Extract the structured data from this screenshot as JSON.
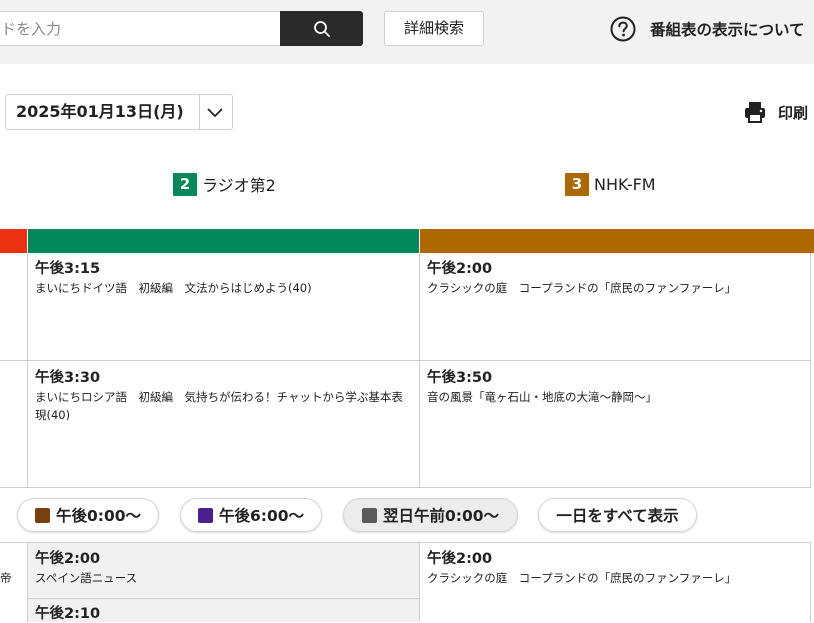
{
  "search": {
    "placeholder": "ドを入力"
  },
  "header": {
    "advanced_search_label": "詳細検索",
    "help_label": "番組表の表示について"
  },
  "date_select": {
    "value": "2025年01月13日(月)"
  },
  "print": {
    "label": "印刷"
  },
  "channels": [
    {
      "number": "2",
      "name": "ラジオ第2",
      "color": "#00875a"
    },
    {
      "number": "3",
      "name": "NHK-FM",
      "color": "#ae6800"
    }
  ],
  "left_channel_color": "#e83211",
  "programs_upper": {
    "radio2": [
      {
        "time": "午後3:15",
        "title": "まいにちドイツ語　初級編　文法からはじめよう(40)"
      },
      {
        "time": "午後3:30",
        "title": "まいにちロシア語　初級編　気持ちが伝わる！チャットから学ぶ基本表現(40)"
      }
    ],
    "fm": [
      {
        "time": "午後2:00",
        "title": "クラシックの庭　コープランドの「庶民のファンファーレ」"
      },
      {
        "time": "午後3:50",
        "title": "音の風景「竜ヶ石山・地底の大滝～静岡～」"
      }
    ]
  },
  "time_filters": [
    {
      "label": "午後0:00～",
      "color": "#7a3f0f",
      "active": false
    },
    {
      "label": "午後6:00～",
      "color": "#4b1f8f",
      "active": false
    },
    {
      "label": "翌日午前0:00～",
      "color": "#5a5a5a",
      "active": true
    },
    {
      "label": "一日をすべて表示",
      "color": "",
      "active": false
    }
  ],
  "programs_lower": {
    "left_edge_text": "帝",
    "radio2": [
      {
        "time": "午後2:00",
        "title": "スペイン語ニュース"
      },
      {
        "time": "午後2:10",
        "title": ""
      }
    ],
    "fm": [
      {
        "time": "午後2:00",
        "title": "クラシックの庭　コープランドの「庶民のファンファーレ」"
      }
    ]
  }
}
